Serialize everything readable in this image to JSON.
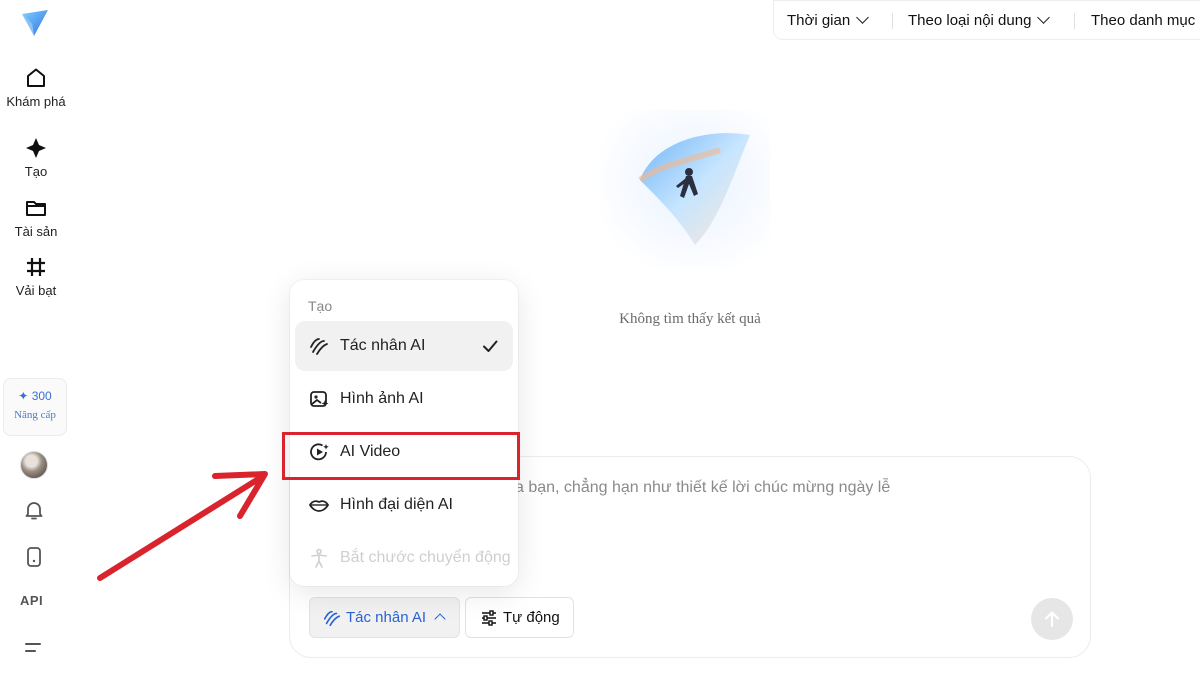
{
  "sidebar": {
    "items": [
      {
        "label": "Khám phá",
        "icon": "home-icon"
      },
      {
        "label": "Tạo",
        "icon": "sparkle-icon"
      },
      {
        "label": "Tài sản",
        "icon": "folder-icon"
      },
      {
        "label": "Vải bạt",
        "icon": "canvas-icon"
      }
    ],
    "credits": {
      "value": "300",
      "upgrade_label": "Nâng cấp"
    },
    "api_label": "API"
  },
  "filters": [
    {
      "label": "Thời gian"
    },
    {
      "label": "Theo loại nội dung"
    },
    {
      "label": "Theo danh mục"
    }
  ],
  "empty_state": {
    "message": "Không tìm thấy kết quả"
  },
  "prompt": {
    "placeholder_visible": "a bạn, chẳng hạn như thiết kế lời chúc mừng ngày lễ",
    "mode_button_label": "Tác nhân AI",
    "auto_button_label": "Tự động"
  },
  "menu": {
    "title": "Tạo",
    "items": [
      {
        "label": "Tác nhân AI",
        "icon": "agent-icon",
        "selected": true
      },
      {
        "label": "Hình ảnh AI",
        "icon": "image-ai-icon",
        "selected": false
      },
      {
        "label": "AI Video",
        "icon": "video-ai-icon",
        "selected": false
      },
      {
        "label": "Hình đại diện AI",
        "icon": "avatar-lips-icon",
        "selected": false
      },
      {
        "label": "Bắt chước chuyển động",
        "icon": "motion-icon",
        "selected": false,
        "disabled": true
      }
    ]
  },
  "colors": {
    "accent": "#2a63d1",
    "annotation_red": "#d9232d",
    "selected_bg": "#f1f1f1"
  }
}
